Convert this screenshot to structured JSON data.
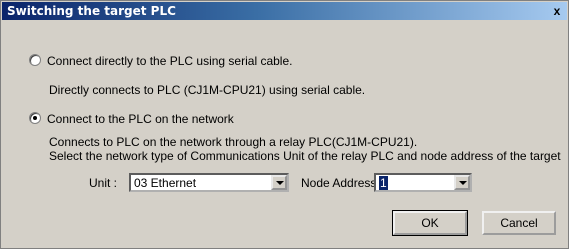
{
  "dialog": {
    "title": "Switching the target PLC",
    "close_label": "x"
  },
  "options": {
    "serial": {
      "label": "Connect directly to the PLC using serial cable.",
      "description": "Directly connects to PLC (CJ1M-CPU21) using serial cable.",
      "selected": false
    },
    "network": {
      "label": "Connect to the PLC on the network",
      "description_line1": "Connects to PLC on the network through a relay PLC(CJ1M-CPU21).",
      "description_line2": "Select the network type of Communications Unit of the relay PLC and node address of the target",
      "selected": true
    }
  },
  "form": {
    "unit_label": "Unit :",
    "unit_value": "03  Ethernet",
    "node_label": "Node Address",
    "node_value": "1"
  },
  "buttons": {
    "ok": "OK",
    "cancel": "Cancel"
  }
}
